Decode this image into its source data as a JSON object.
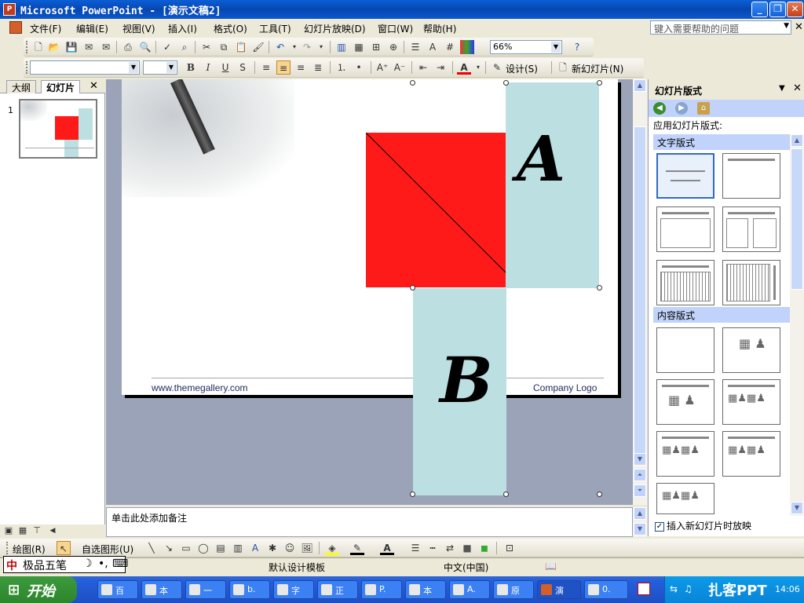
{
  "window": {
    "title": "Microsoft PowerPoint - [演示文稿2]",
    "app_icon": "P"
  },
  "menu": {
    "items": [
      "文件(F)",
      "编辑(E)",
      "视图(V)",
      "插入(I)",
      "格式(O)",
      "工具(T)",
      "幻灯片放映(D)",
      "窗口(W)",
      "帮助(H)"
    ],
    "help_placeholder": "键入需要帮助的问题"
  },
  "toolbar": {
    "zoom": "66%",
    "design_label": "设计(S)",
    "new_slide_label": "新幻灯片(N)"
  },
  "left_panel": {
    "tabs": [
      "大纲",
      "幻灯片"
    ],
    "active_tab": "幻灯片",
    "slide_number": "1"
  },
  "slide": {
    "footer_url": "www.themegallery.com",
    "footer_logo": "Company Logo",
    "label_a": "A",
    "label_b": "B",
    "colors": {
      "red": "#ff1a1a",
      "blue": "#bcdfe2"
    }
  },
  "notes": {
    "placeholder": "单击此处添加备注"
  },
  "task_pane": {
    "title": "幻灯片版式",
    "apply_label": "应用幻灯片版式:",
    "section_text": "文字版式",
    "section_content": "内容版式",
    "checkbox_label": "插入新幻灯片时放映",
    "checkbox_checked": true
  },
  "drawing_toolbar": {
    "draw_label": "绘图(R)",
    "autoshape_label": "自选图形(U)"
  },
  "status": {
    "template": "默认设计模板",
    "language": "中文(中国)"
  },
  "ime": {
    "label": "极品五笔"
  },
  "taskbar": {
    "start": "开始",
    "tasks": [
      "百",
      "本",
      "一",
      "b.",
      "字",
      "正",
      "P.",
      "本",
      "A.",
      "原",
      "演",
      "0."
    ],
    "clock": "14:06",
    "watermark": "扎客PPT"
  }
}
